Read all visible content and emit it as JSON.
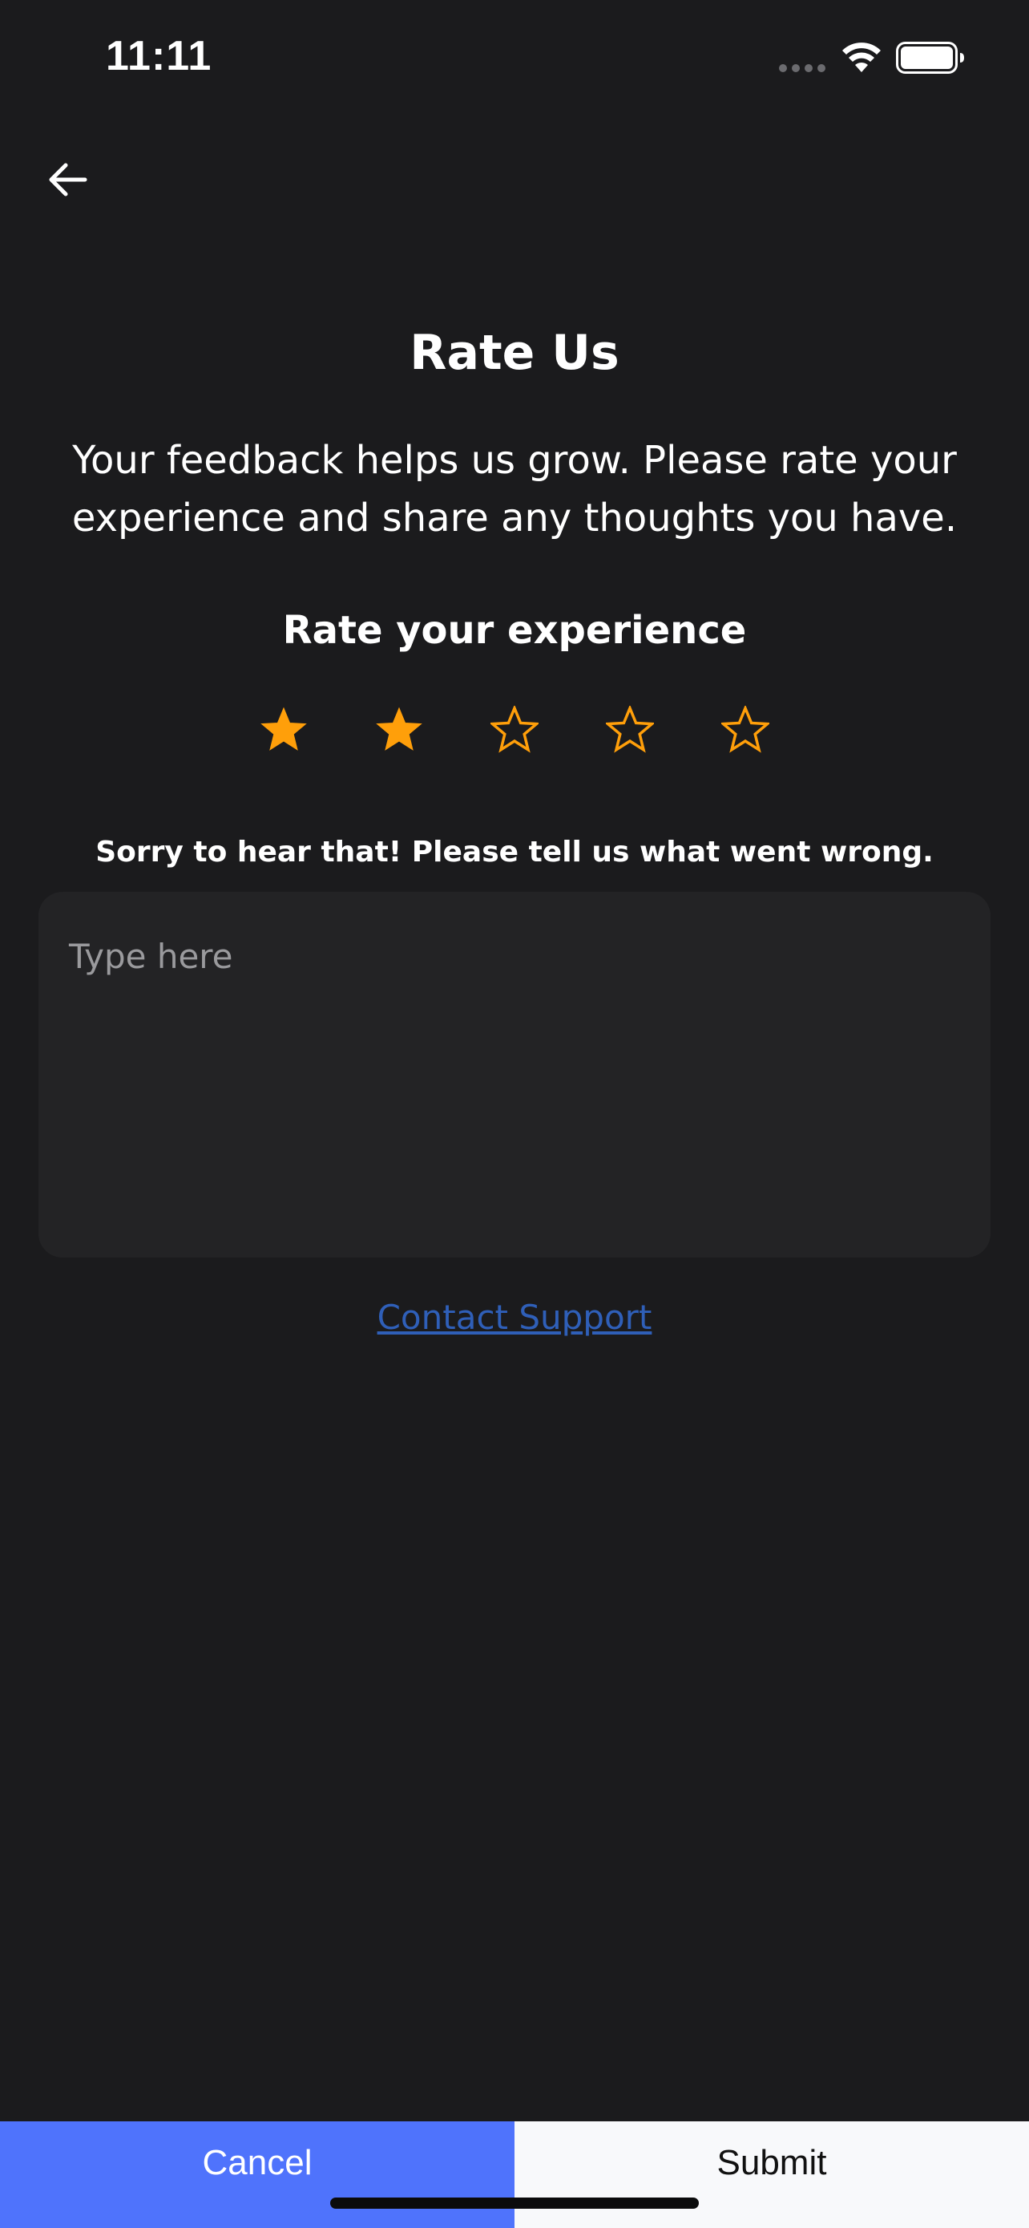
{
  "status_bar": {
    "time": "11:11"
  },
  "page": {
    "title": "Rate Us",
    "subtitle": "Your feedback helps us grow. Please rate your experience and share any thoughts you have.",
    "rate_label": "Rate your experience",
    "rating": 2,
    "rating_max": 5,
    "sorry_text": "Sorry to hear that! Please tell us what went wrong.",
    "feedback_placeholder": "Type here",
    "feedback_value": "",
    "contact_support": "Contact Support"
  },
  "buttons": {
    "cancel": "Cancel",
    "submit": "Submit"
  },
  "colors": {
    "background": "#1b1b1d",
    "star": "#ff9f0a",
    "link": "#2f5fb8",
    "cancel_bg": "#4f73fc",
    "submit_bg": "#f8f9fb"
  },
  "icons": {
    "back": "arrow-left-icon",
    "star_filled": "star-filled-icon",
    "star_outline": "star-outline-icon",
    "wifi": "wifi-icon",
    "battery": "battery-icon"
  }
}
